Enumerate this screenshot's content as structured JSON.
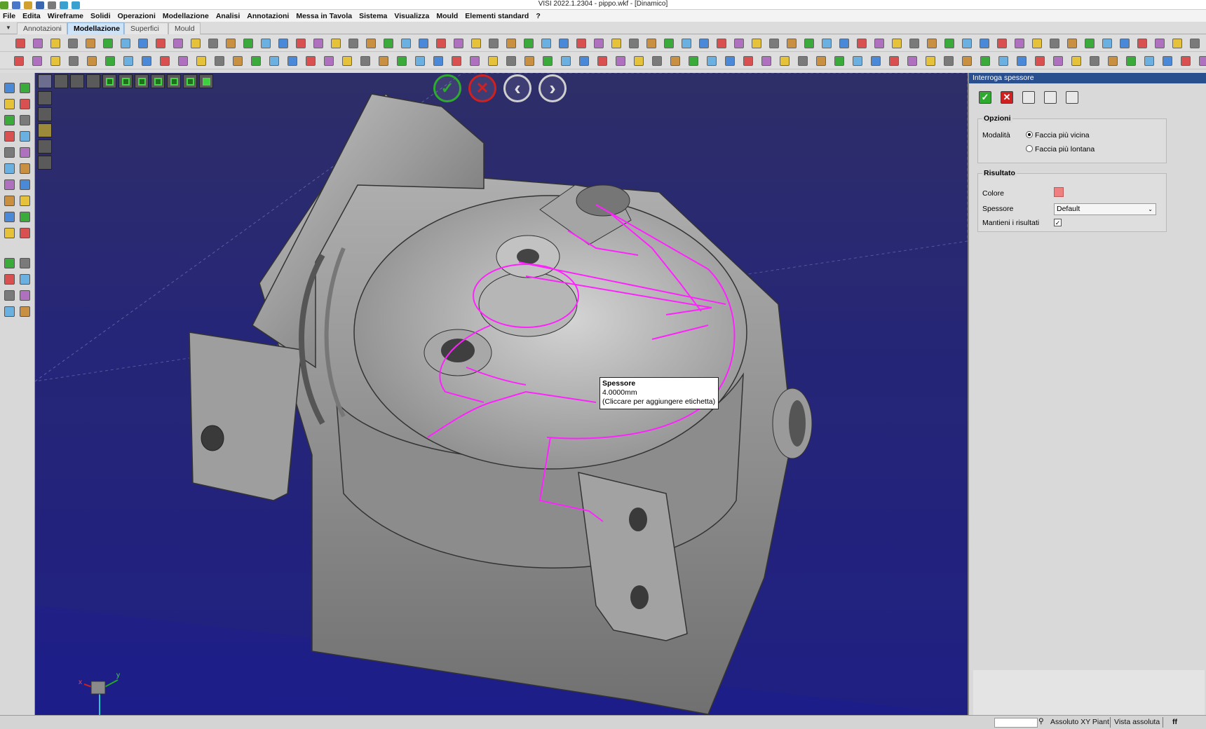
{
  "window": {
    "title": "VISI 2022.1.2304 - pippo.wkf - [Dinamico]"
  },
  "menu": [
    "File",
    "Edita",
    "Wireframe",
    "Solidi",
    "Operazioni",
    "Modellazione",
    "Analisi",
    "Annotazioni",
    "Messa in Tavola",
    "Sistema",
    "Visualizza",
    "Mould",
    "Elementi standard",
    "?"
  ],
  "ribbon_tabs": [
    "Annotazioni",
    "Modellazione",
    "Superfici",
    "Mould"
  ],
  "active_tab": "Modellazione",
  "confirm_bar": {
    "accept": "✓",
    "cancel": "✕",
    "prev": "‹",
    "next": "›"
  },
  "tooltip": {
    "title": "Spessore",
    "value": "4.0000mm",
    "hint": "(Cliccare per aggiungere etichetta)"
  },
  "panel": {
    "title": "Interroga spessore",
    "options": {
      "label": "Opzioni",
      "mode_label": "Modalità",
      "mode_options": [
        "Faccia più vicina",
        "Faccia più lontana"
      ],
      "mode_selected": "Faccia più vicina"
    },
    "result": {
      "label": "Risultato",
      "color_label": "Colore",
      "color": "#f08080",
      "thickness_label": "Spessore",
      "thickness_value": "Default",
      "keep_label": "Mantieni i risultati",
      "keep_checked": true
    }
  },
  "axes": {
    "x": "x",
    "y": "y"
  },
  "status": {
    "coord_mode": "Assoluto XY Piant",
    "view": "Vista assoluta",
    "extra": "ff"
  },
  "colors": {
    "highlight": "#ff22ff",
    "accent_green": "#2eaa2e",
    "accent_red": "#d02020"
  }
}
